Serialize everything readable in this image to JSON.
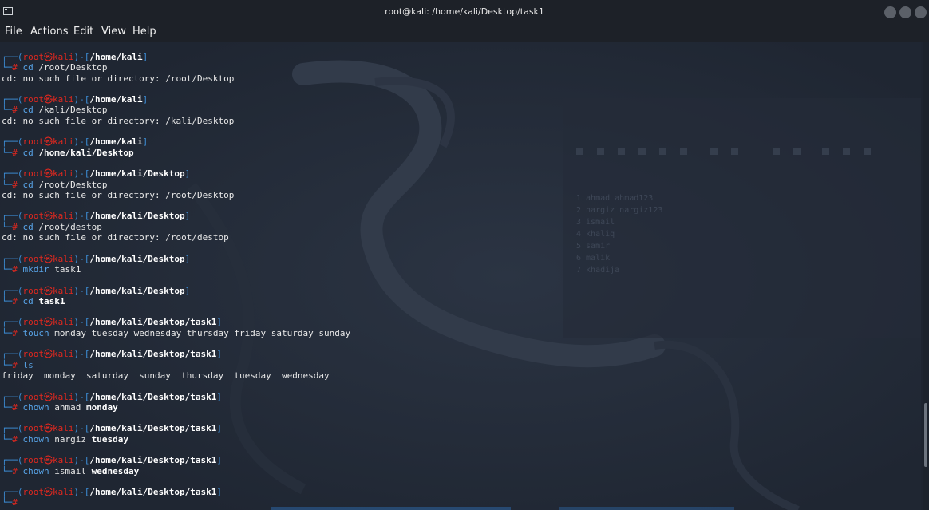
{
  "window": {
    "title": "root@kali: /home/kali/Desktop/task1"
  },
  "menu": {
    "items": [
      "File",
      "Actions",
      "Edit",
      "View",
      "Help"
    ]
  },
  "terminal": {
    "prompt": {
      "user": "root",
      "at": "㉿",
      "host": "kali",
      "hash": "#"
    },
    "entries": [
      {
        "path": "/home/kali",
        "cmd": "cd",
        "args": [
          {
            "t": "/root/Desktop",
            "bold": false
          }
        ],
        "output": "cd: no such file or directory: /root/Desktop"
      },
      {
        "path": "/home/kali",
        "cmd": "cd",
        "args": [
          {
            "t": "/kali/Desktop",
            "bold": false
          }
        ],
        "output": "cd: no such file or directory: /kali/Desktop"
      },
      {
        "path": "/home/kali",
        "cmd": "cd",
        "args": [
          {
            "t": "/home/kali/Desktop",
            "bold": true
          }
        ],
        "output": null
      },
      {
        "path": "/home/kali/Desktop",
        "cmd": "cd",
        "args": [
          {
            "t": "/root/Desktop",
            "bold": false
          }
        ],
        "output": "cd: no such file or directory: /root/Desktop"
      },
      {
        "path": "/home/kali/Desktop",
        "cmd": "cd",
        "args": [
          {
            "t": "/root/destop",
            "bold": false
          }
        ],
        "output": "cd: no such file or directory: /root/destop"
      },
      {
        "path": "/home/kali/Desktop",
        "cmd": "mkdir",
        "args": [
          {
            "t": "task1",
            "bold": false
          }
        ],
        "output": null
      },
      {
        "path": "/home/kali/Desktop",
        "cmd": "cd",
        "args": [
          {
            "t": "task1",
            "bold": true
          }
        ],
        "output": null
      },
      {
        "path": "/home/kali/Desktop/task1",
        "cmd": "touch",
        "args": [
          {
            "t": "monday tuesday wednesday thursday friday saturday sunday",
            "bold": false
          }
        ],
        "output": null
      },
      {
        "path": "/home/kali/Desktop/task1",
        "cmd": "ls",
        "args": [],
        "output": "friday  monday  saturday  sunday  thursday  tuesday  wednesday"
      },
      {
        "path": "/home/kali/Desktop/task1",
        "cmd": "chown",
        "args": [
          {
            "t": "ahmad",
            "bold": false
          },
          {
            "t": "monday",
            "bold": true
          }
        ],
        "output": null
      },
      {
        "path": "/home/kali/Desktop/task1",
        "cmd": "chown",
        "args": [
          {
            "t": "nargiz",
            "bold": false
          },
          {
            "t": "tuesday",
            "bold": true
          }
        ],
        "output": null
      },
      {
        "path": "/home/kali/Desktop/task1",
        "cmd": "chown",
        "args": [
          {
            "t": "ismail",
            "bold": false
          },
          {
            "t": "wednesday",
            "bold": true
          }
        ],
        "output": null
      },
      {
        "path": "/home/kali/Desktop/task1",
        "cmd": null,
        "args": [],
        "output": null
      }
    ]
  },
  "background_editor": {
    "lines": [
      "1 ahmad ahmad123",
      "2 nargiz nargiz123",
      "3 ismail",
      "4 khaliq",
      "5 samir",
      "6 malik",
      "7 khadija"
    ]
  },
  "colors": {
    "prompt_frame": "#3d8fd8",
    "prompt_user": "#e0281f",
    "command": "#58a4e8",
    "text": "#e8e8e8",
    "background": "#1f2632"
  }
}
